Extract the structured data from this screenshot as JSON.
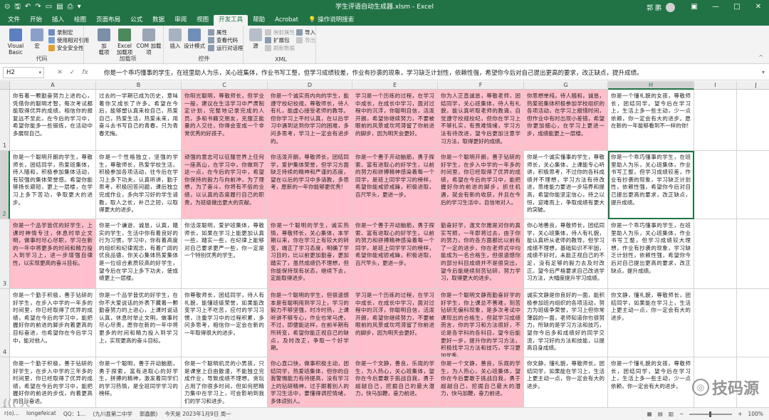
{
  "window": {
    "title": "学生评语自动生成器.xlsm  -  Excel",
    "user": "郭 鹏",
    "qat_autosave": "⊙",
    "controls": [
      "—",
      "□",
      "✕"
    ]
  },
  "tabs": [
    "文件",
    "开始",
    "插入",
    "绘图",
    "页面布局",
    "公式",
    "数据",
    "审阅",
    "视图",
    "开发工具",
    "帮助",
    "Acrobat",
    "💡 操作说明搜索"
  ],
  "active_tab_index": 9,
  "ribbon": {
    "code": {
      "visual_basic": "Visual Basic",
      "macros": "宏",
      "record": "录制宏",
      "relative": "使用相对引用",
      "security": "安全安全性",
      "label": "代码"
    },
    "addins": {
      "addins": "加\n载项",
      "excel_addins": "Excel\n加载项",
      "com_addins": "COM 加载项",
      "label": "加载项"
    },
    "controls": {
      "insert": "插入",
      "design": "设计模式",
      "properties": "属性",
      "view_code": "查看代码",
      "run_dialog": "运行对话框",
      "label": "控件"
    },
    "xml": {
      "source": "源",
      "map_props": "映射属性",
      "expansion": "扩展包",
      "refresh": "刷新数据",
      "import": "导入",
      "export": "导出",
      "label": "XML"
    }
  },
  "formula_bar": {
    "name_box": "H2",
    "content": "你是一个乖巧懂事的学生，在班里助人为乐，关心班集体，作业书写工整，但学习成绩较差，作业有抄袭的现象，学习缺乏计划性，依赖性强，希望你今后对自己提出更高的要求，改正缺点，提升成绩。"
  },
  "columns": [
    "A",
    "B",
    "C",
    "D",
    "E",
    "F",
    "G",
    "H",
    "I",
    "J"
  ],
  "selected_column": "H",
  "rows": [
    "1",
    "2",
    "3",
    "4",
    "5"
  ],
  "selected_row": "2",
  "cells": [
    [
      "你有着一颗勤奋努力上进的心，凭借你的聪明才智，每次考试都能取得优异的成绩。相信你的报复远不至此，在今后的学习中，希望你能多一些锻炼，在活动中多展现自己。",
      "过去的一学期已成为历史，意味着你又成长了许多。希望在今后，能够塑认真来校自己，热爱自己，热爱生活，热爱未来，用奋斗去书写自己的青春，只为青春无悔。",
      "你阳光聪明，尊敬师长，但学业一般，建议在生活学习中严肃制定计划，完整地记录完成的人员，多和书籍交朋友，克服正能量的人交往，你得会变成一个非常优秀的好孩子。",
      "你是一个诚实而内向的学生，能遵守校纪校规，尊敬师长，待人有礼，能虚心接受老师的教导。但你学习上平时认真，在以后学习中遇到这到你学习的困难，多问多思考，学习上一定会有进步的。",
      "学习是一个历练的过程，在学习中成长，在成长中学习，面对过程中的沉浮，你聪明自信，活泼开朗，希望你继续努力，不要被眼前的风景或坎坷滞留了你前进的脚步，因为明天会更好。",
      "你为人正直诚恳，尊敬老师，团结同学，关心班集体，待人有礼貌，能认真听取老师的教诲，自觉遵守校规校纪，但你在学习上不够扎实，有畏难情绪，学习方法有待改进，望今后更加注意学习方法，取得更好的成绩。",
      "你思想单纯，待人随和，诚恳，热爱班集体积极参加学校组织的各项活动，在学习上报惜时间，但作业中有时出现小差错，希望你更加细心，在学习上更进一步，成绩能更上一层楼。",
      "你是一个懂礼貌的女孩，尊敬师长，团结同学。望今后在学习上，生活上多一些主动，少一点依赖，你一定会有大的进步。愿在新的一年能够看到不一样的你!",
      "",
      ""
    ],
    [
      "你是一个聪明开朗的学生，尊敬师长，团结同学，热爱班集体，待人随和，积极参加集体活动，有较强的集体荣誉感。希望你能够扬长避短，更上一层楼，在学习上多下苦功，争取更大的进步。",
      "你是一个性格独立，坚强的学生，尊敬师长，热爱学校生活，积极参加各项活动，往今后在学习上多下功夫，认真听讲，勤于思考，积极回答问题，课后独立完成作业，多向学习好的学生请教，取人之长，补己之短，以取得更大的进步。",
      "顽强的意志可以征服世界上任何一座高山，在学习中，你做到了这一点，在今后的学习中，希望你保持的毅力与向前冲，为了理想，为了奋斗，你将有不俗的业绩，以认真的态度履行自己的职责，为班级做出更大的贡献。",
      "你活泼开朗，尊敬师长，团结同学，爱护集体荣誉，但学习方面缺乏持续的精神和严谨的态度，望在以后的学习中多请教，多思考，愿新的一年你能够更优秀!",
      "你是一个善于开动脑筋，勇于探索、富有进取心的好学生，以前的努力和拼搏精神感染着每一个同学，是班上同学学习的榜样，希望你能戒骄戒躁，积极进取，百尺竿头，更进一步。",
      "你是一个聪明开朗，善于钻研的好学生，在步入中学的一年多的时间里，你已经取得了优异的成绩，希望在今后的学习中，能把握好你的前进的脚步，抓住机遇，就会有新的收获，并且在今后的学习生活中，自信地对人。",
      "你是一个诚实懂事的学生，尊敬师长，关心集体，上课能专心听讲，积极思考，不过你的各科成绩并不理想，学习方法有待改进，思维能力要进一步培养和提高，希望你能坚定信心，持之以恒，迎难而上，争取成绩有更大的突破。",
      "你是一个乖巧懂事的学生，在班里助人为乐，关心班集体，作业书写工整，但学习成绩较差，作业有抄袭的现象，学习缺乏计划性，依赖性强，希望你今后对自己提出更高的要求，改正缺点，提升成绩。",
      "",
      ""
    ],
    [
      "你是一个品学皆优的好学生，上课时神情专注，休息时举止文明，做事时尽心尽职，学习在新的一年中将更多的时间和精力投入到学习上，进一步增强自律性，以实现更高的奋斗目标。",
      "你是一个谦逊、诚恳，认真，踏实的学生，生活中你有着良好的行为习惯，学习中，你有着高度的组织和纪律观念，有着广阔的优良品德，你关心集体热爱集体是一位综合素质较高的好学生，望今后在学习上多下功夫，使成绩更上一层楼。",
      "你活泼聪明，爱护班集体，尊敬师长，如果在学习上能更加认真一些，踏实一些，在纪律上能够对自己要求更严一些，你一定是一个特别优秀的学生。",
      "你是一个聪明的学生，诚实热情，尊敬师长，关心集体，本学期以来，你在学习上有较大的转变，端正了学习态度，明确了学习目的，比以前更加勤奋，更加踏实了，虽然成绩仍不理想，但你能保持现有状态，继续下去，定能取得进步。",
      "你是一个善于开动脑筋，勇于探索、富有进取心的好学生，以前的努力和拼搏精神感染着每一个同学，是班上同学学习的榜样，希望你能戒骄戒躁，积极进取，百尺竿头，更进一步。",
      "勤奋好学，温文尔雅是对你的真实写照，一年即将过去，由于你的努力，你的各方面都比以前有了一定的进步，你在老师式中均能成为一名合格生，但很遗憾你的部分科目成绩并不是很突出，望今后能继续刻苦钻研，努力学习，取得更大的进步。",
      "你心地善良，尊敬师长，团结同学，关心班集体，待人有礼貌，能认真听从老师的教导，但学习成绩不理想，基础知识不牢固，成绩不好时，未能正视自己的不足，没有足够的毅力去及时改正。望今后严格要求自己改进学习方法，大幅度提升学习成绩。",
      "你是一个乖巧懂事的学生，在班里助人为乐，关心班集体，作业书写工整，但学习成绩较大理想，作业有抄袭的现象，学习缺乏计划性，依赖性强，希望你今后对自己提出更高的要求，改正缺点，提升成绩。",
      "",
      ""
    ],
    [
      "你是一个勤于积极，善于钻研的好学生，在步入中学的一年多的时间里，你已经取得了优异的成绩，希望在今后的学习中，能把握好你的前进的脚步向着更高的目标奋进，也希望你在今后学习中，能对他人。",
      "你是一个品学皆优的好学生，在你不大爱说话的外表下藏着一颗勤奋努力的上进心，上课时说话认真，休息时举止文明，做事时尽心尽责，愿你在新的一年中将更多的时间和精力投入到学习上，实现更高的奋斗目标。",
      "你尊敬师长，团结同学，待人有礼貌，能懂班级荣誉，如果能改变学习上不吃苦，应付的学习习惯，注重学习中的过程积累，多问多思考，相信你一定会在新的一年取得很大的进步。",
      "你是一个聪明的学生，但很遗憾本是有聪明用到学习上，学习的毅力不够坚强，时冷时热，上课听讲不够专心，作业也常马虎，不过，即便能这样，在前半期有所转变，希望你能正视自己的缺点，及时改正，争取一个好学期。",
      "学习是一个历练的过程，在学习中成长，在成长中学习，面对过程中的沉浮，你聪明自信，活泼开朗，希望你继续努力，不要被眼前的风景或坎坷滞留了你前进的脚步，因为明天会更好。",
      "你是一个聪明文静而勤奋好学的好学生，你上课总不善难，刻苦钻研无偏科现象，是多次考试中课现出的合格生，但就学习成绩而言，你的学习和方法很好，不论是各学科的各科目，望今后能更好一步，提升你的学习方法，积极找学习方法和技巧，学习更加优秀。",
      "诚实文静是你良好的一面，能积极参加班内组织的各项活动，努力为班级争荣誉，学习上但你常薄弱的一面，老师知道你也很努力，所缺的是学习方法和技巧，望你今后多和成绩好的同学交流，学习好的方法和技能，以提高自身成绩。",
      "你文静，懂礼貌，尊敬师长，团结同学，如果能在学习上，生活上更主动一点，你一定会有大的进步。",
      "",
      ""
    ],
    [
      "你是一个勤于积极，善于钻研的好学生，在步入中学的三年多的时间里，你已经取得了优异的成绩，希望在今后的学习中，能把握好你的前进的步伐，向着更高的目标奋进。",
      "你是一个聪明，善于开动脑筋，勇于探索，富有进取心的好学生，拼搏的精神，激发着同学们的学习热情，是全班同学学习的榜样。",
      "你是一个聪明机灵的小男孩，只是课堂上自由散漫，不能独立完成作业，导致成绩不理想。贪玩占用了你很多时间，但如何把精力集中在学习上，可会影响到我们的学习和进步。",
      "你心直口快，做事积极主动，团结同学，热爱班集体，但你的自我警惕能力有待提高，没有学习上的钻研精神，过于跟着别人的学习生活中，要懂得调控情绪，多体谅别人。",
      "你是一个文静，善良，乐观的学生，为人热心，关心班集体，望你在今后要敢于挑战自我，勇于超越自己，挖掘自己的最大潜力，快马加鞭，奋力前进。",
      "你是一个文静，善良，乐观的学生，为人热心，关心班集体，望你在今后要敢于挑战自我，勇于超越自己，挖掘自己最大的潜力，快马加鞭，奋力前进。",
      "你文静，懂礼貌，尊敬师长，团结同学，如果能在学习上，生活上更主动一点，你一定会有大的进步。",
      "你是一个懂礼貌的女孩，尊敬师长，团结同学，望今后在学习上，生活上多一些主动，少一点依赖，你一定会有大的进步。",
      "",
      ""
    ]
  ],
  "pink_cells": [
    [
      0,
      2
    ],
    [
      0,
      3
    ],
    [
      0,
      4
    ],
    [
      0,
      5
    ],
    [
      0,
      6
    ],
    [
      1,
      2
    ],
    [
      1,
      3
    ],
    [
      1,
      4
    ],
    [
      1,
      5
    ],
    [
      2,
      0
    ],
    [
      2,
      3
    ],
    [
      2,
      4
    ],
    [
      2,
      5
    ],
    [
      3,
      3
    ],
    [
      3,
      4
    ],
    [
      3,
      5
    ],
    [
      4,
      3
    ],
    [
      4,
      4
    ],
    [
      4,
      5
    ]
  ],
  "statusbar": {
    "items": [
      "r(o)…",
      "longefeicat",
      "QQ：1…",
      "(九川县第二中学",
      "郭鑫鹏)",
      "今天是 2023年1月9日 周一"
    ],
    "zoom": "100%"
  },
  "watermark": "技码源",
  "colors": {
    "accent": "#217346",
    "pink": "#ffc0cb"
  }
}
